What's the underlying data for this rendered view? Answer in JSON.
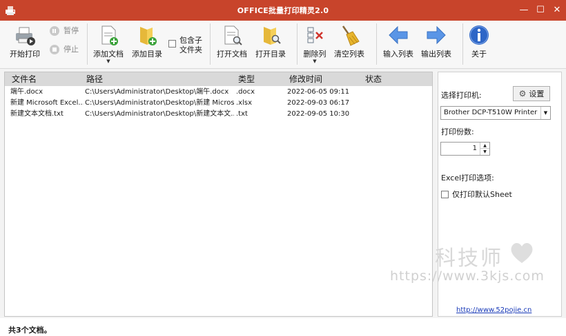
{
  "window": {
    "title": "OFFICE批量打印精灵2.0",
    "controls": {
      "minimize": "—",
      "maximize": "☐",
      "close": "✕"
    }
  },
  "toolbar": {
    "start": "开始打印",
    "pause": "暂停",
    "stop": "停止",
    "add_doc": "添加文档",
    "add_dir": "添加目录",
    "include_sub_line1": "包含子",
    "include_sub_line2": "文件夹",
    "open_doc": "打开文档",
    "open_dir": "打开目录",
    "delete_col": "删除列",
    "clear_list": "清空列表",
    "import_list": "输入列表",
    "export_list": "输出列表",
    "about": "关于"
  },
  "table": {
    "headers": [
      "文件名",
      "路径",
      "类型",
      "修改时间",
      "状态"
    ],
    "rows": [
      [
        "端午.docx",
        "C:\\Users\\Administrator\\Desktop\\端午.docx",
        ".docx",
        "2022-06-05 09:11",
        ""
      ],
      [
        "新建 Microsoft Excel...",
        "C:\\Users\\Administrator\\Desktop\\新建 Micros...",
        ".xlsx",
        "2022-09-03 06:17",
        ""
      ],
      [
        "新建文本文档.txt",
        "C:\\Users\\Administrator\\Desktop\\新建文本文...",
        ".txt",
        "2022-09-05 10:30",
        ""
      ]
    ]
  },
  "side": {
    "printer_label": "选择打印机:",
    "settings": "设置",
    "printer_value": "Brother DCP-T510W Printer",
    "copies_label": "打印份数:",
    "copies_value": "1",
    "excel_label": "Excel打印选项:",
    "default_sheet": "仅打印默认Sheet",
    "link": "http://www.52pojie.cn"
  },
  "status": "共3个文档。",
  "watermark": {
    "title": "科技师",
    "url": "https://www.3kjs.com"
  }
}
